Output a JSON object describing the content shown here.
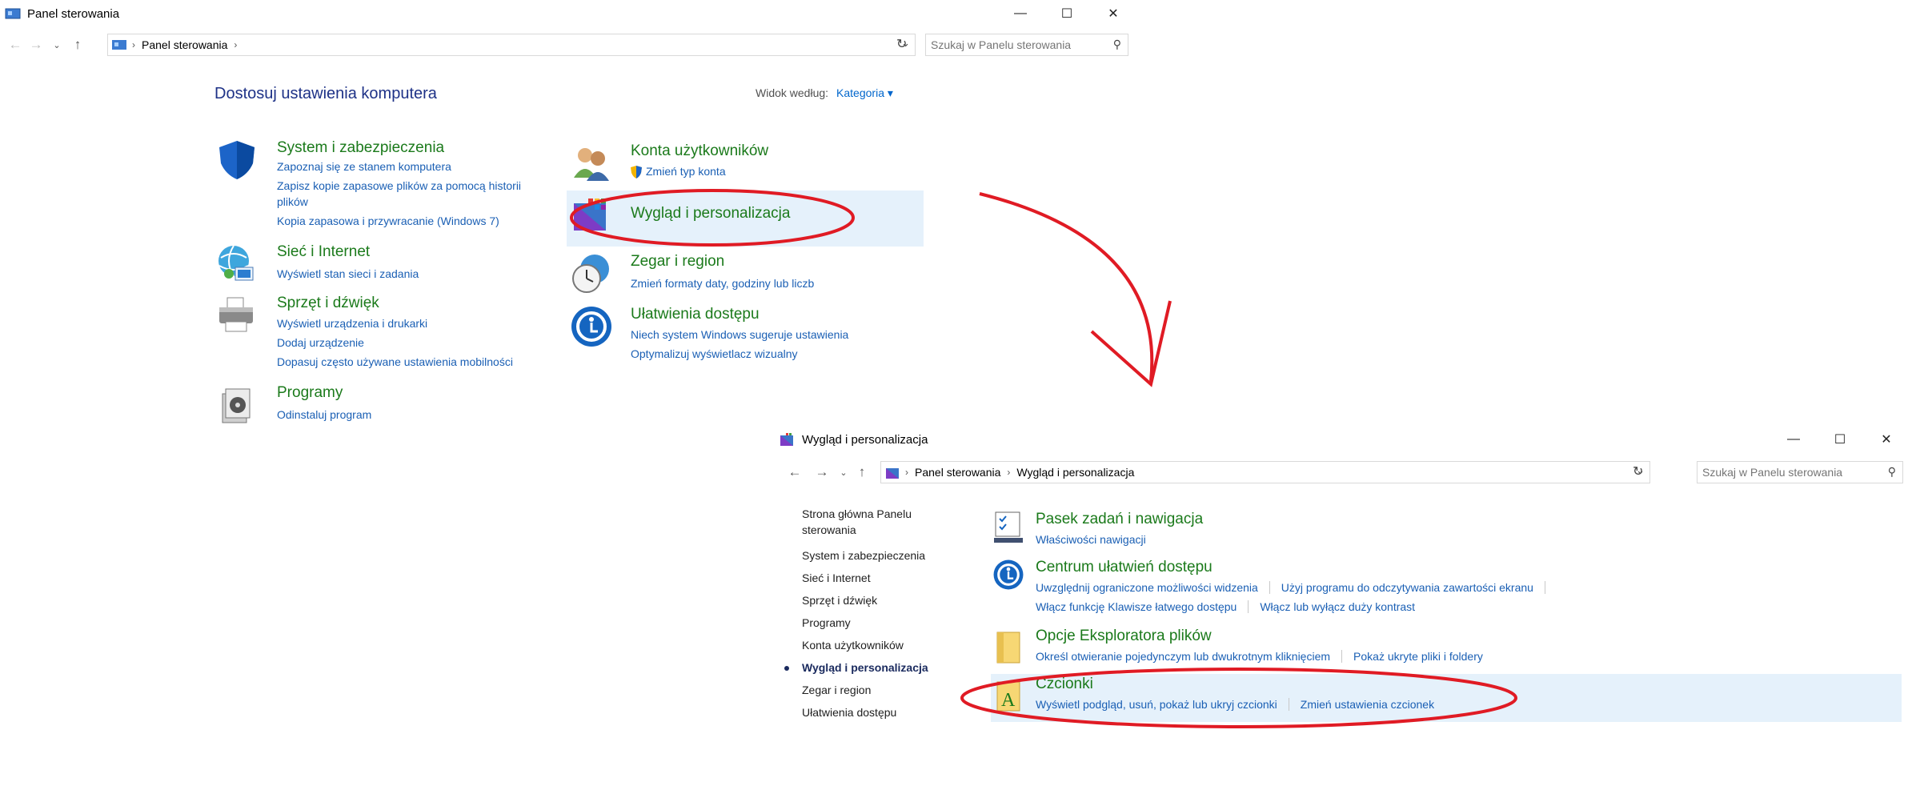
{
  "window1": {
    "title": "Panel sterowania",
    "address": [
      "Panel sterowania"
    ],
    "search_placeholder": "Szukaj w Panelu sterowania",
    "heading": "Dostosuj ustawienia komputera",
    "view_by_label": "Widok według:",
    "view_by_value": "Kategoria ▾",
    "categories": [
      {
        "title": "System i zabezpieczenia",
        "links": [
          "Zapoznaj się ze stanem komputera",
          "Zapisz kopie zapasowe plików za pomocą historii",
          "plików",
          "Kopia zapasowa i przywracanie (Windows 7)"
        ]
      },
      {
        "title": "Sieć i Internet",
        "links": [
          "Wyświetl stan sieci i zadania"
        ]
      },
      {
        "title": "Sprzęt i dźwięk",
        "links": [
          "Wyświetl urządzenia i drukarki",
          "Dodaj urządzenie",
          "Dopasuj często używane ustawienia mobilności"
        ]
      },
      {
        "title": "Programy",
        "links": [
          "Odinstaluj program"
        ]
      },
      {
        "title": "Konta użytkowników",
        "links": [
          "Zmień typ konta"
        ]
      },
      {
        "title": "Wygląd i personalizacja",
        "links": []
      },
      {
        "title": "Zegar i region",
        "links": [
          "Zmień formaty daty, godziny lub liczb"
        ]
      },
      {
        "title": "Ułatwienia dostępu",
        "links": [
          "Niech system Windows sugeruje ustawienia",
          "Optymalizuj wyświetlacz wizualny"
        ]
      }
    ]
  },
  "window2": {
    "title": "Wygląd i personalizacja",
    "address": [
      "Panel sterowania",
      "Wygląd i personalizacja"
    ],
    "search_placeholder": "Szukaj w Panelu sterowania",
    "sidebar": [
      "Strona główna Panelu",
      "sterowania",
      "System i zabezpieczenia",
      "Sieć i Internet",
      "Sprzęt i dźwięk",
      "Programy",
      "Konta użytkowników",
      "Wygląd i personalizacja",
      "Zegar i region",
      "Ułatwienia dostępu"
    ],
    "sections": [
      {
        "title": "Pasek zadań i nawigacja",
        "links": [
          "Właściwości nawigacji"
        ]
      },
      {
        "title": "Centrum ułatwień dostępu",
        "links": [
          "Uwzględnij ograniczone możliwości widzenia",
          "Użyj programu do odczytywania zawartości ekranu",
          "Włącz funkcję Klawisze łatwego dostępu",
          "Włącz lub wyłącz duży kontrast"
        ]
      },
      {
        "title": "Opcje Eksploratora plików",
        "links": [
          "Określ otwieranie pojedynczym lub dwukrotnym kliknięciem",
          "Pokaż ukryte pliki i foldery"
        ]
      },
      {
        "title": "Czcionki",
        "links": [
          "Wyświetl podgląd, usuń, pokaż lub ukryj czcionki",
          "Zmień ustawienia czcionek"
        ]
      }
    ]
  },
  "colors": {
    "annotation": "#e01b24",
    "link": "#1a5fb4",
    "heading": "#1b7a1b",
    "highlight": "#e5f1fb"
  }
}
